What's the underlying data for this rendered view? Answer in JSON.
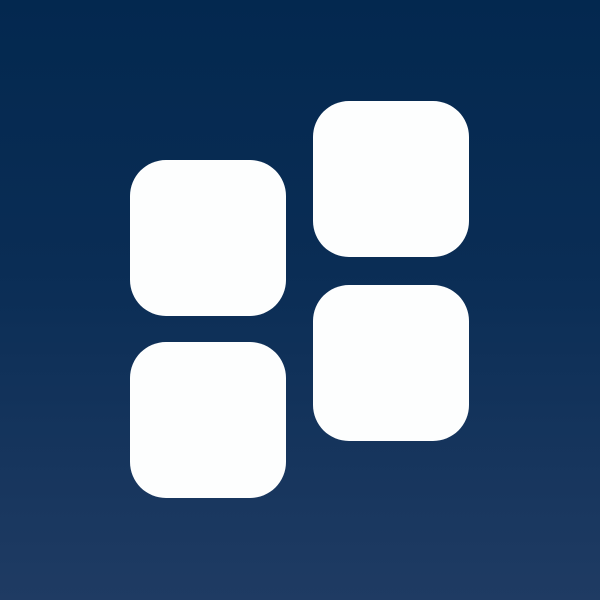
{
  "icon": {
    "name": "apps-grid-icon",
    "tile_color": "#fdfefe",
    "background_top": "#03284f",
    "background_bottom": "#1f3b63"
  }
}
